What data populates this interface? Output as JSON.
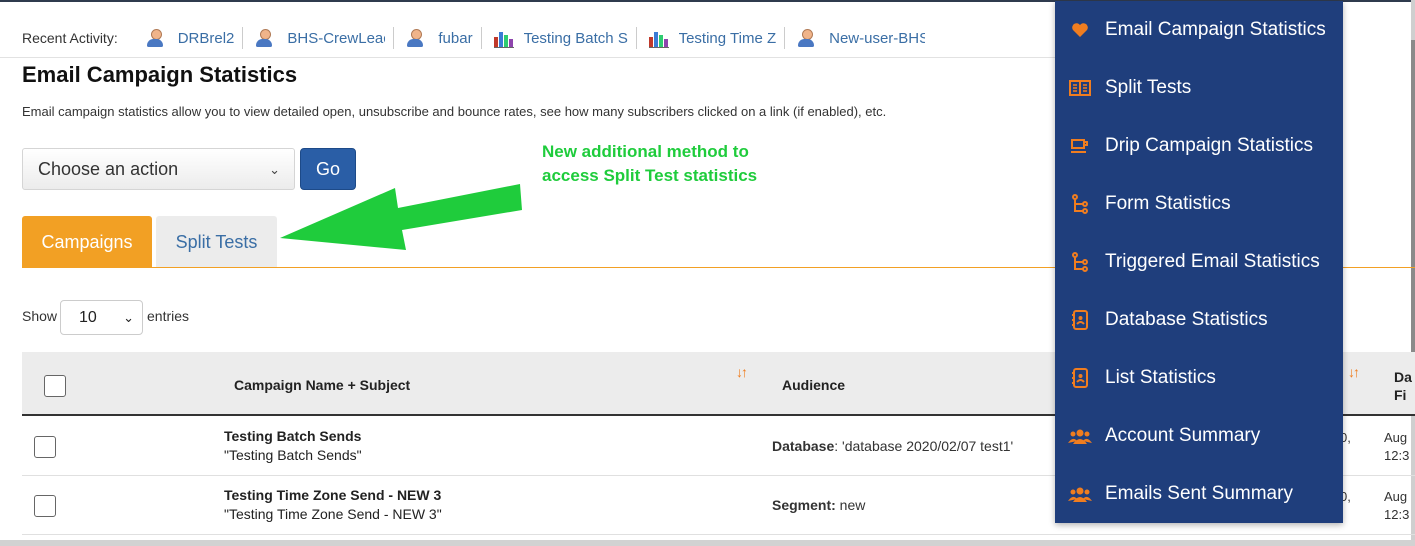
{
  "recent": {
    "label": "Recent Activity:",
    "items": [
      {
        "type": "user",
        "text": "DRBrel2"
      },
      {
        "type": "user",
        "text": "BHS-CrewLeac"
      },
      {
        "type": "user",
        "text": "fubar"
      },
      {
        "type": "chart",
        "text": "Testing Batch S"
      },
      {
        "type": "chart",
        "text": "Testing Time Z"
      },
      {
        "type": "user",
        "text": "New-user-BHS"
      }
    ]
  },
  "page": {
    "title": "Email Campaign Statistics",
    "description": "Email campaign statistics allow you to view detailed open, unsubscribe and bounce rates, see how many subscribers clicked on a link (if enabled), etc."
  },
  "action": {
    "select_value": "Choose an action",
    "go_label": "Go"
  },
  "annotation": {
    "line1": "New additional method to",
    "line2": "access Split Test statistics"
  },
  "tabs": [
    {
      "label": "Campaigns",
      "active": true
    },
    {
      "label": "Split Tests",
      "active": false
    }
  ],
  "entries": {
    "show_label": "Show",
    "value": "10",
    "suffix": "entries"
  },
  "table": {
    "headers": {
      "name": "Campaign Name + Subject",
      "audience": "Audience",
      "date_top": "Da",
      "date_bottom": "Fi"
    },
    "rows": [
      {
        "name": "Testing Batch Sends",
        "subject": "\"Testing Batch Sends\"",
        "audience_label": "Database",
        "audience_value": ": 'database 2020/02/07 test1'",
        "col_a": "0,",
        "col_b_top": "Aug",
        "col_b_bottom": "12:3"
      },
      {
        "name": "Testing Time Zone Send - NEW 3",
        "subject": "\"Testing Time Zone Send - NEW 3\"",
        "audience_label": "Segment:",
        "audience_value": " new",
        "col_a": "0,",
        "col_b_top": "Aug",
        "col_b_bottom": "12:3"
      }
    ]
  },
  "menu": {
    "items": [
      {
        "icon": "heart-icon",
        "label": "Email Campaign Statistics"
      },
      {
        "icon": "split-icon",
        "label": "Split Tests"
      },
      {
        "icon": "cup-icon",
        "label": "Drip Campaign Statistics"
      },
      {
        "icon": "flow-icon",
        "label": "Form Statistics"
      },
      {
        "icon": "flow-icon",
        "label": "Triggered Email Statistics"
      },
      {
        "icon": "contact-book-icon",
        "label": "Database Statistics"
      },
      {
        "icon": "contact-book-icon",
        "label": "List Statistics"
      },
      {
        "icon": "group-icon",
        "label": "Account Summary"
      },
      {
        "icon": "group-icon",
        "label": "Emails Sent Summary"
      }
    ]
  },
  "colors": {
    "menu_bg": "#1f3e7c",
    "accent_orange": "#f2a024",
    "link_blue": "#3a6ea5",
    "annotation_green": "#1fcc3c",
    "go_button": "#2a5ea6"
  }
}
